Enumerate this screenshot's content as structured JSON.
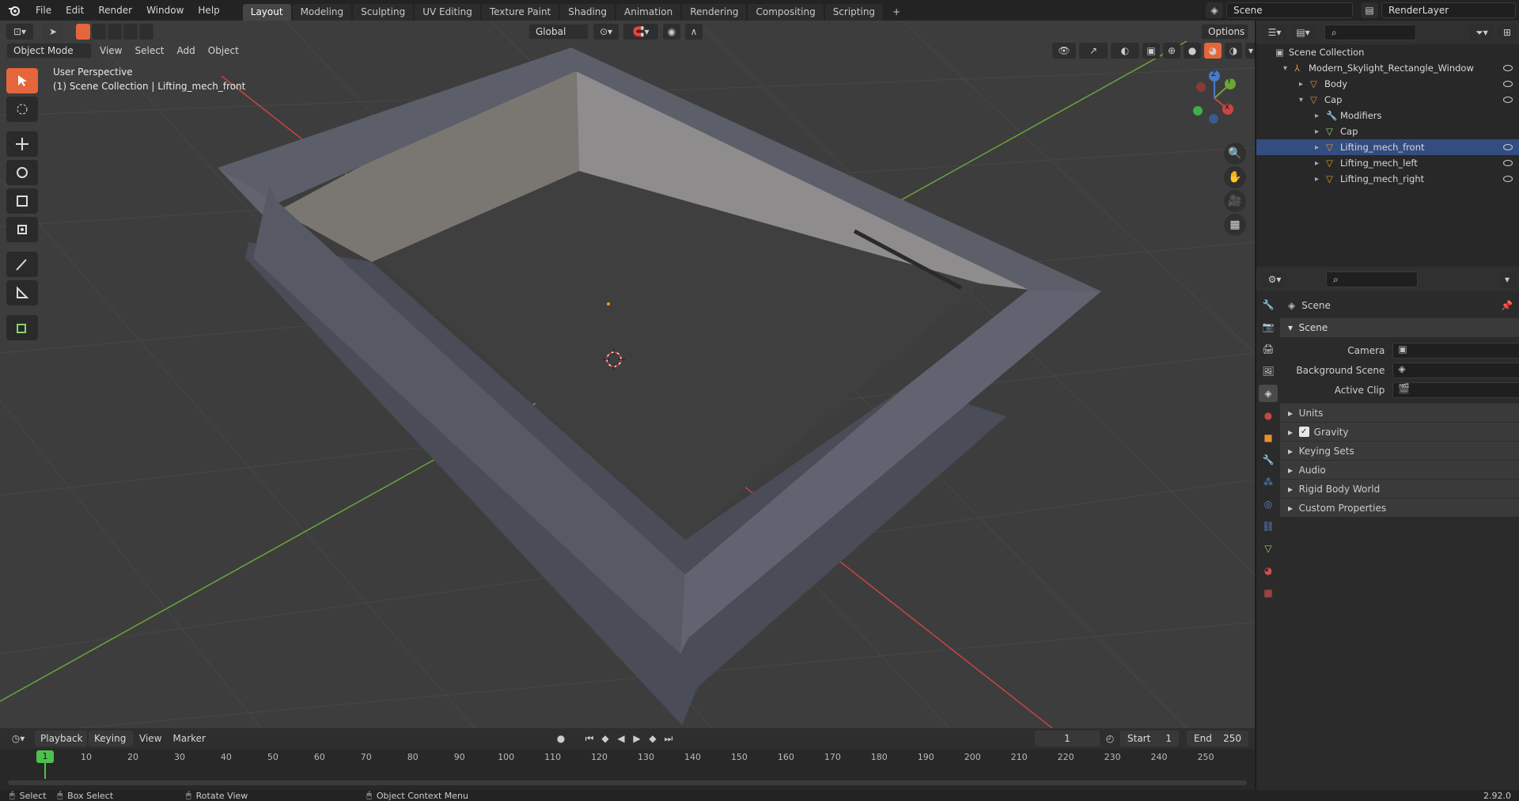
{
  "topbar": {
    "menus": [
      "File",
      "Edit",
      "Render",
      "Window",
      "Help"
    ],
    "workspaces": [
      "Layout",
      "Modeling",
      "Sculpting",
      "UV Editing",
      "Texture Paint",
      "Shading",
      "Animation",
      "Rendering",
      "Compositing",
      "Scripting"
    ],
    "active_workspace": "Layout",
    "add_tab": "+",
    "scene_name": "Scene",
    "view_layer": "RenderLayer"
  },
  "viewport": {
    "mode": "Object Mode",
    "menus": [
      "View",
      "Select",
      "Add",
      "Object"
    ],
    "orientation": "Global",
    "options_label": "Options",
    "perspective_label": "User Perspective",
    "collection_label": "(1) Scene Collection | Lifting_mech_front",
    "gizmo_axes": {
      "x": "X",
      "y": "Y",
      "z": "Z"
    }
  },
  "outliner": {
    "root": "Scene Collection",
    "items": [
      {
        "label": "Modern_Skylight_Rectangle_Window",
        "indent": 1,
        "expanded": true,
        "type": "collection"
      },
      {
        "label": "Body",
        "indent": 2,
        "expanded": false,
        "type": "object"
      },
      {
        "label": "Cap",
        "indent": 2,
        "expanded": true,
        "type": "object"
      },
      {
        "label": "Modifiers",
        "indent": 3,
        "expanded": false,
        "type": "modifier"
      },
      {
        "label": "Cap",
        "indent": 3,
        "expanded": false,
        "type": "mesh"
      },
      {
        "label": "Lifting_mech_front",
        "indent": 3,
        "expanded": false,
        "type": "object",
        "selected": true
      },
      {
        "label": "Lifting_mech_left",
        "indent": 3,
        "expanded": false,
        "type": "object"
      },
      {
        "label": "Lifting_mech_right",
        "indent": 3,
        "expanded": false,
        "type": "object"
      }
    ]
  },
  "properties": {
    "context_title": "Scene",
    "panel_title": "Scene",
    "fields": [
      {
        "label": "Camera",
        "value": ""
      },
      {
        "label": "Background Scene",
        "value": ""
      },
      {
        "label": "Active Clip",
        "value": ""
      }
    ],
    "subpanels": [
      "Units",
      "Gravity",
      "Keying Sets",
      "Audio",
      "Rigid Body World",
      "Custom Properties"
    ]
  },
  "timeline": {
    "menus": [
      "Playback",
      "Keying",
      "View",
      "Marker"
    ],
    "current_frame": "1",
    "start_label": "Start",
    "start": "1",
    "end_label": "End",
    "end": "250",
    "ruler": [
      "1",
      "10",
      "20",
      "30",
      "40",
      "50",
      "60",
      "70",
      "80",
      "90",
      "100",
      "110",
      "120",
      "130",
      "140",
      "150",
      "160",
      "170",
      "180",
      "190",
      "200",
      "210",
      "220",
      "230",
      "240",
      "250"
    ]
  },
  "statusbar": {
    "select": "Select",
    "box_select": "Box Select",
    "rotate_view": "Rotate View",
    "context_menu": "Object Context Menu",
    "version": "2.92.0"
  },
  "colors": {
    "accent": "#e5663a",
    "viewport_bg": "#3d3d3d",
    "x_axis": "#c94545",
    "y_axis": "#6aa53a",
    "frame_marker": "#4ec04e"
  }
}
